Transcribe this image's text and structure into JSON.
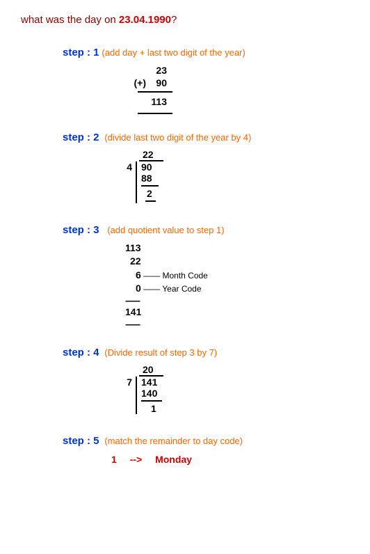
{
  "question": {
    "prefix": "what was the day on ",
    "date": "23.04.1990",
    "suffix": "?"
  },
  "step1": {
    "label": "step  : 1",
    "desc": "(add day + last two digit of the year)",
    "plus": "(+)",
    "line1": "23",
    "line2": "90",
    "result": "113"
  },
  "step2": {
    "label": "step : 2",
    "desc": "(divide last two digit of the year by 4)",
    "quotient": "22",
    "divisor": "4",
    "dividend": "90",
    "sub": "88",
    "remainder": "2"
  },
  "step3": {
    "label": "step : 3",
    "desc": "(add quotient value to step 1)",
    "line1": "113",
    "line2": "22",
    "line3": "6",
    "line3_label": " —— Month Code",
    "line4": "0",
    "line4_label": " —— Year Code",
    "result": "141"
  },
  "step4": {
    "label": "step : 4",
    "desc": "(Divide result of step 3 by 7)",
    "quotient": "20",
    "divisor": "7",
    "dividend": "141",
    "sub": "140",
    "remainder": "1"
  },
  "step5": {
    "label": "step : 5",
    "desc": "(match the remainder to day code)",
    "code": "1",
    "arrow": "-->",
    "day": "Monday"
  }
}
